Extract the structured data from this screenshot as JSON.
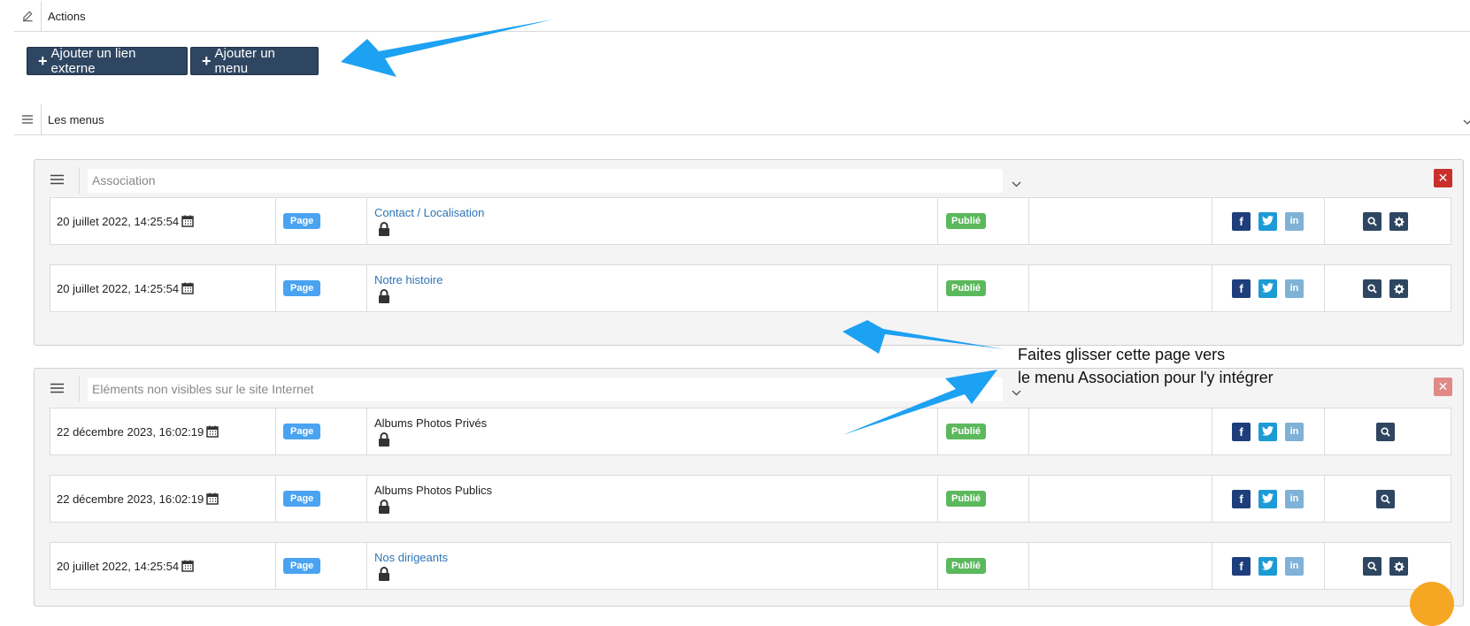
{
  "actions_section": {
    "label": "Actions",
    "icon": "edit-icon"
  },
  "buttons": {
    "add_external_link": "Ajouter un lien externe",
    "add_menu": "Ajouter un menu"
  },
  "menus_section": {
    "label": "Les menus",
    "icon": "hamburger-icon"
  },
  "panels": [
    {
      "name": "Association",
      "rows": [
        {
          "date": "20 juillet 2022, 14:25:54",
          "type": "Page",
          "title": "Contact / Localisation",
          "status": "Publié"
        },
        {
          "date": "20 juillet 2022, 14:25:54",
          "type": "Page",
          "title": "Notre histoire",
          "status": "Publié"
        }
      ]
    },
    {
      "name": "Eléments non visibles sur le site Internet",
      "rows": [
        {
          "date": "22 décembre 2023, 16:02:19",
          "type": "Page",
          "title": "Albums Photos Privés",
          "status": "Publié"
        },
        {
          "date": "22 décembre 2023, 16:02:19",
          "type": "Page",
          "title": "Albums Photos Publics",
          "status": "Publié"
        },
        {
          "date": "20 juillet 2022, 14:25:54",
          "type": "Page",
          "title": "Nos dirigeants",
          "status": "Publié"
        }
      ]
    }
  ],
  "annotation": {
    "line1": "Faites glisser cette page vers",
    "line2": "le menu Association pour l'y intégrer"
  },
  "social": {
    "facebook": "f",
    "linkedin": "in"
  },
  "colors": {
    "button_dark": "#2e4661",
    "published": "#5cb85c",
    "page_badge": "#4aa3f0",
    "arrow": "#1da1f2",
    "delete": "#c9302c"
  }
}
